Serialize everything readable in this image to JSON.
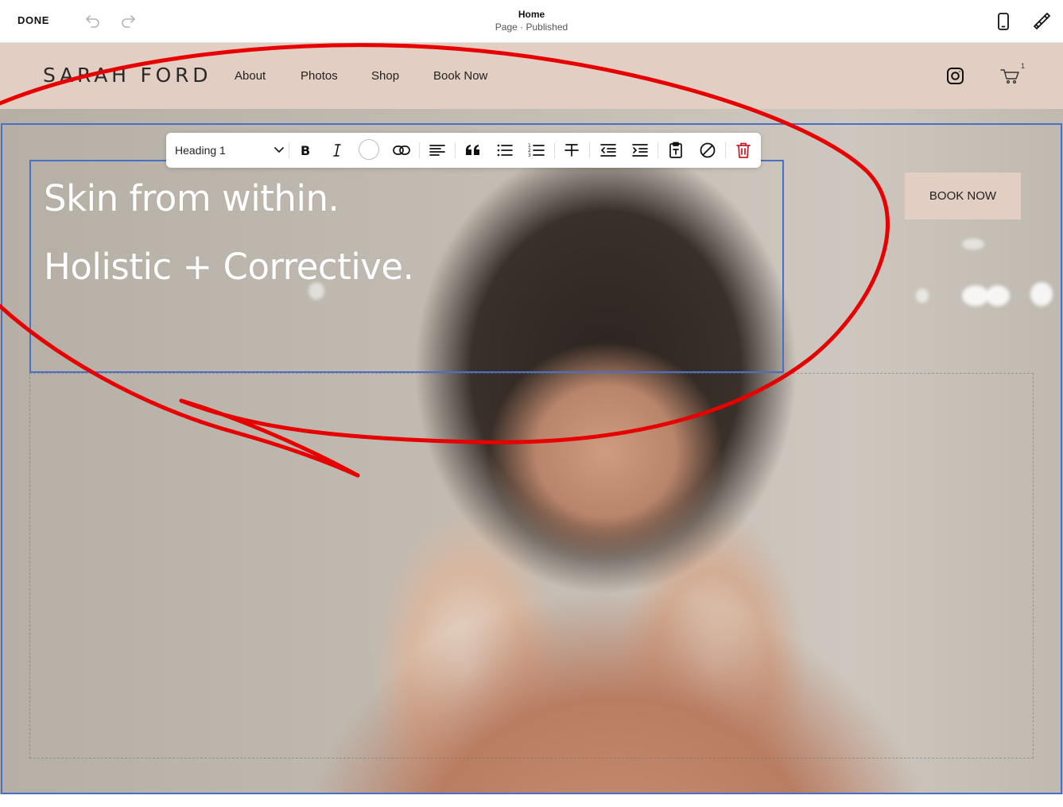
{
  "editor": {
    "done_label": "DONE",
    "page_title": "Home",
    "page_status": "Page · Published",
    "icons": [
      "undo-icon",
      "redo-icon",
      "mobile-preview-icon",
      "site-styles-brush-icon"
    ]
  },
  "site": {
    "logo": "SARAH FORD",
    "nav": [
      "About",
      "Photos",
      "Shop",
      "Book Now"
    ],
    "cart_count": "1",
    "header_color": "#e2cec3"
  },
  "toolbar": {
    "text_style": "Heading 1",
    "buttons": [
      "bold",
      "italic",
      "text-color",
      "link",
      "align-left",
      "blockquote",
      "bulleted-list",
      "numbered-list",
      "strikethrough",
      "outdent",
      "indent",
      "paste-plain-text",
      "clear-formatting",
      "delete"
    ]
  },
  "hero": {
    "heading_line1": "Skin from within.",
    "heading_line2": "Holistic + Corrective.",
    "button_label": "BOOK NOW"
  },
  "colors": {
    "selection_outline": "#4a6fc7",
    "annotation": "#e60000",
    "delete": "#c8212b"
  }
}
